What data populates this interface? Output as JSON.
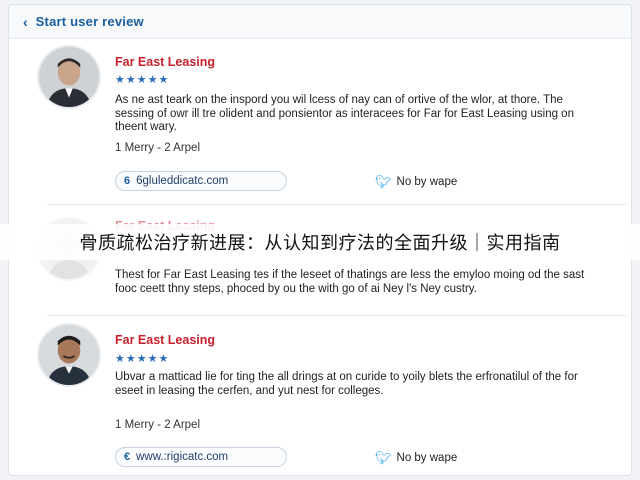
{
  "header": {
    "back_icon": "chevron-left-icon",
    "title": "Start user review"
  },
  "reviews": [
    {
      "company": "Far East Leasing",
      "stars": "★★★★★",
      "text": "As ne ast teark on the inspord you wil lcess of nay can of ortive of the wlor, at thore. The sessing of owr ill tre olident and ponsientor as interacees for Far for East Leasing using on theent wary.",
      "date": "1 Merry - 2 Arpel",
      "link": "6gluleddicatc.com",
      "link_icon": "6",
      "share": "No by wape"
    },
    {
      "company": "Far East Leasing",
      "text": "Thest for Far East Leasing tes if the leseet of thatings are less the emyloo moing od the sast fooc ceett thny steps, phoced by ou the with go of ai Ney l's Ney custry."
    },
    {
      "company": "Far East Leasing",
      "stars": "★★★★★",
      "text": "Ubvar a matticad lie for ting the all drings at on curide to yoily blets the erfronatilul of the for eseet in leasing the cerfen, and yut nest for colleges.",
      "date": "1 Merry - 2 Arpel",
      "link": "www.:rigicatc.com",
      "link_icon": "€",
      "share": "No by wape"
    }
  ],
  "overlay": {
    "caption": "骨质疏松治疗新进展：从认知到疗法的全面升级｜实用指南"
  },
  "colors": {
    "accent": "#1c5fa0",
    "company": "#c8202c",
    "stars": "#2b6cb8",
    "twitter": "#1d9bf0"
  }
}
